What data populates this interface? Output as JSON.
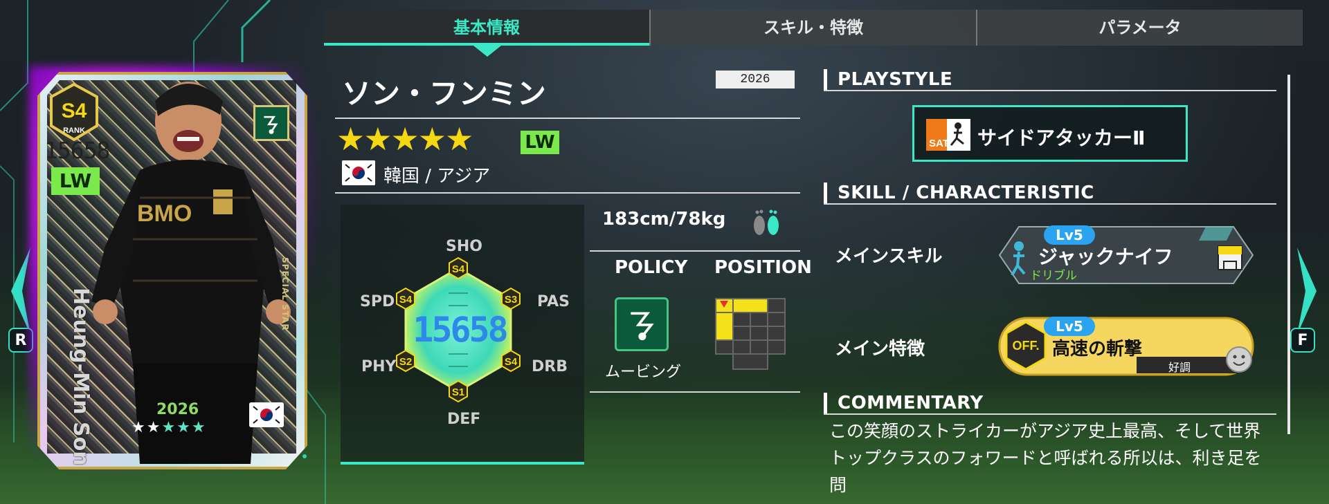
{
  "tabs": [
    {
      "label": "基本情報",
      "active": true
    },
    {
      "label": "スキル・特徴",
      "active": false
    },
    {
      "label": "パラメータ",
      "active": false
    }
  ],
  "side_keys": {
    "left": "R",
    "right": "F"
  },
  "card": {
    "rank": "S4",
    "rank_label": "RANK",
    "overall": "15658",
    "position": "LW",
    "name": "Heung-Min Son",
    "special": "SPECIAL STAR",
    "year": "2026",
    "stars": 5,
    "sponsor": "BMO"
  },
  "player": {
    "name": "ソン・フンミン",
    "year_tag": "2026",
    "stars": "★★★★★",
    "position": "LW",
    "nation": "韓国 / アジア",
    "height_weight": "183cm/78kg"
  },
  "radar": {
    "total": "15658",
    "stats": [
      {
        "label": "SHO",
        "grade": "S4"
      },
      {
        "label": "PAS",
        "grade": "S3"
      },
      {
        "label": "DRB",
        "grade": "S4"
      },
      {
        "label": "DEF",
        "grade": "S1"
      },
      {
        "label": "PHY",
        "grade": "S2"
      },
      {
        "label": "SPD",
        "grade": "S4"
      }
    ]
  },
  "policy": {
    "heading": "POLICY",
    "name": "ムービング"
  },
  "position_section": {
    "heading": "POSITION"
  },
  "playstyle": {
    "title": "PLAYSTYLE",
    "icon_label": "SAT",
    "name": "サイドアタッカーⅡ"
  },
  "skill_section": {
    "title": "SKILL / CHARACTERISTIC",
    "main_skill_label": "メインスキル",
    "main_skill": {
      "level": "Lv5",
      "name": "ジャックナイフ",
      "category": "ドリブル"
    },
    "main_trait_label": "メイン特徴",
    "main_trait": {
      "level": "Lv5",
      "badge": "OFF.",
      "name": "高速の斬撃",
      "condition": "好調"
    }
  },
  "commentary": {
    "title": "COMMENTARY",
    "line1": "この笑顔のストライカーがアジア史上最高、そして世界",
    "line2": "トップクラスのフォワードと呼ばれる所以は、利き足を問"
  },
  "colors": {
    "accent": "#3be8c6",
    "position_badge": "#7be84c",
    "star": "#f5d712",
    "level_pill": "#2aa3f0",
    "trait_gold": "#f5d760"
  }
}
